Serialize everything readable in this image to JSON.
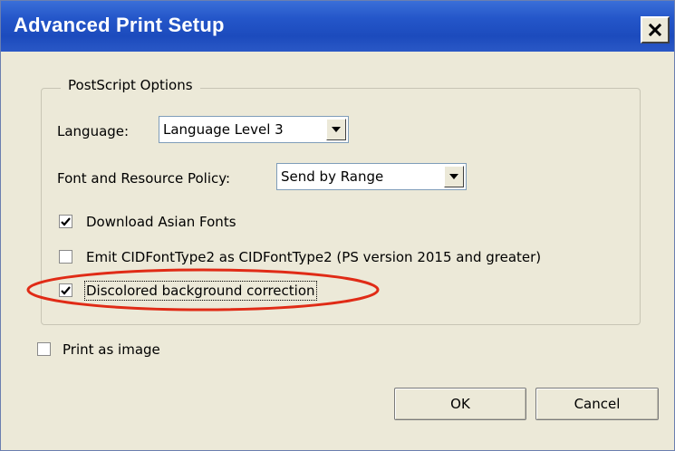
{
  "window": {
    "title": "Advanced Print Setup",
    "close_label": "×"
  },
  "postscript_group": {
    "title": "PostScript Options",
    "language": {
      "label": "Language:",
      "value": "Language Level 3"
    },
    "font_policy": {
      "label": "Font and Resource Policy:",
      "value": "Send by Range"
    },
    "options": [
      {
        "label": "Download Asian Fonts",
        "checked": true
      },
      {
        "label": "Emit CIDFontType2 as CIDFontType2 (PS version 2015 and greater)",
        "checked": false
      },
      {
        "label": "Discolored background correction",
        "checked": true
      }
    ]
  },
  "print_as_image": {
    "label": "Print as image",
    "checked": false
  },
  "buttons": {
    "ok": "OK",
    "cancel": "Cancel"
  },
  "colors": {
    "titlebar": "#1c4bbd",
    "dialog_bg": "#ece9d8",
    "annotation": "#e02b16"
  },
  "icons": {
    "close": "close-icon",
    "dropdown": "chevron-down-icon",
    "check": "checkmark-icon"
  }
}
